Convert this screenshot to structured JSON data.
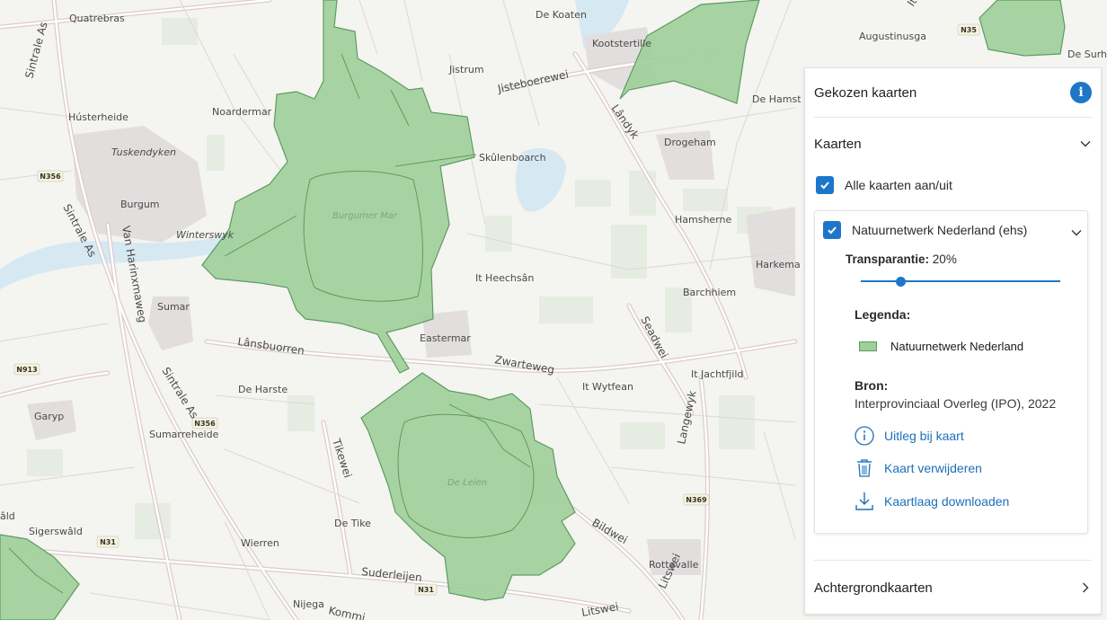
{
  "map": {
    "places": [
      {
        "id": "quatrebras",
        "name": "Quatrebras"
      },
      {
        "id": "de-koaten",
        "name": "De Koaten"
      },
      {
        "id": "augustinusga",
        "name": "Augustinusga"
      },
      {
        "id": "de-surhuis",
        "name": "De Surhu"
      },
      {
        "id": "kootstertille",
        "name": "Kootstertille"
      },
      {
        "id": "jistrum",
        "name": "Jistrum"
      },
      {
        "id": "husterheide",
        "name": "Hústerheide"
      },
      {
        "id": "noardermar",
        "name": "Noardermar"
      },
      {
        "id": "de-hamst",
        "name": "De Hamst"
      },
      {
        "id": "drogeham",
        "name": "Drogeham"
      },
      {
        "id": "skulenboarch",
        "name": "Skûlenboarch"
      },
      {
        "id": "tuskendyken",
        "name": "Tuskendyken"
      },
      {
        "id": "burgum",
        "name": "Burgum"
      },
      {
        "id": "winterswyk",
        "name": "Winterswyk"
      },
      {
        "id": "hamsherne",
        "name": "Hamsherne"
      },
      {
        "id": "harkema",
        "name": "Harkema"
      },
      {
        "id": "it-heechsan",
        "name": "It Heechsân"
      },
      {
        "id": "barchhiem",
        "name": "Barchhiem"
      },
      {
        "id": "sumar",
        "name": "Sumar"
      },
      {
        "id": "eastermar",
        "name": "Eastermar"
      },
      {
        "id": "it-jachtfjild",
        "name": "It Jachtfjild"
      },
      {
        "id": "it-wytfean",
        "name": "It Wytfean"
      },
      {
        "id": "de-harste",
        "name": "De Harste"
      },
      {
        "id": "garyp",
        "name": "Garyp"
      },
      {
        "id": "sumarreheide",
        "name": "Sumarreheide"
      },
      {
        "id": "ald",
        "name": "âld"
      },
      {
        "id": "sigerswald",
        "name": "Sigerswâld"
      },
      {
        "id": "de-tike",
        "name": "De Tike"
      },
      {
        "id": "wierren",
        "name": "Wierren"
      },
      {
        "id": "rottevalle",
        "name": "Rottevalle"
      },
      {
        "id": "nijega",
        "name": "Nijega"
      }
    ],
    "roads": {
      "sintrale_as": "Sintrale As",
      "jisteboerewei": "Jisteboerewei",
      "landyk": "Lândyk",
      "van_harinxmaweg": "Van Harinxmaweg",
      "lansbuorren": "Lânsbuorren",
      "zwarteweg": "Zwarteweg",
      "seadwei": "Seadwei",
      "langewyk": "Langewyk",
      "tikewei": "Tikewei",
      "bildwei": "Bildwei",
      "suderleijen": "Suderleijen",
      "litswei": "Litswei",
      "kommi": "Kommi",
      "it_g": "It G"
    },
    "shields": {
      "n356": "N356",
      "n913": "N913",
      "n31": "N31",
      "n369": "N369",
      "n35": "N35"
    },
    "water": {
      "burgumer_mar": "Burgumer Mar",
      "de_leien": "De Leien"
    },
    "colors": {
      "nature": "#9fcf9a",
      "nature_stroke": "#5f9a5f",
      "water": "#d6e8f2",
      "road": "#ffffff",
      "road_casing": "#d9c9c9"
    }
  },
  "panel": {
    "title": "Gekozen kaarten",
    "info_icon": "info-icon",
    "kaarten_section": "Kaarten",
    "toggle_all_label": "Alle kaarten aan/uit",
    "layer": {
      "name": "Natuurnetwerk Nederland (ehs)",
      "transparency_label": "Transparantie:",
      "transparency_value": "20%",
      "transparency_fraction": 0.2,
      "legend_title": "Legenda:",
      "legend_item": "Natuurnetwerk Nederland",
      "source_title": "Bron:",
      "source_value": "Interprovinciaal Overleg (IPO), 2022",
      "actions": {
        "explain": "Uitleg bij kaart",
        "remove": "Kaart verwijderen",
        "download": "Kaartlaag downloaden"
      }
    },
    "background_section": "Achtergrondkaarten"
  }
}
